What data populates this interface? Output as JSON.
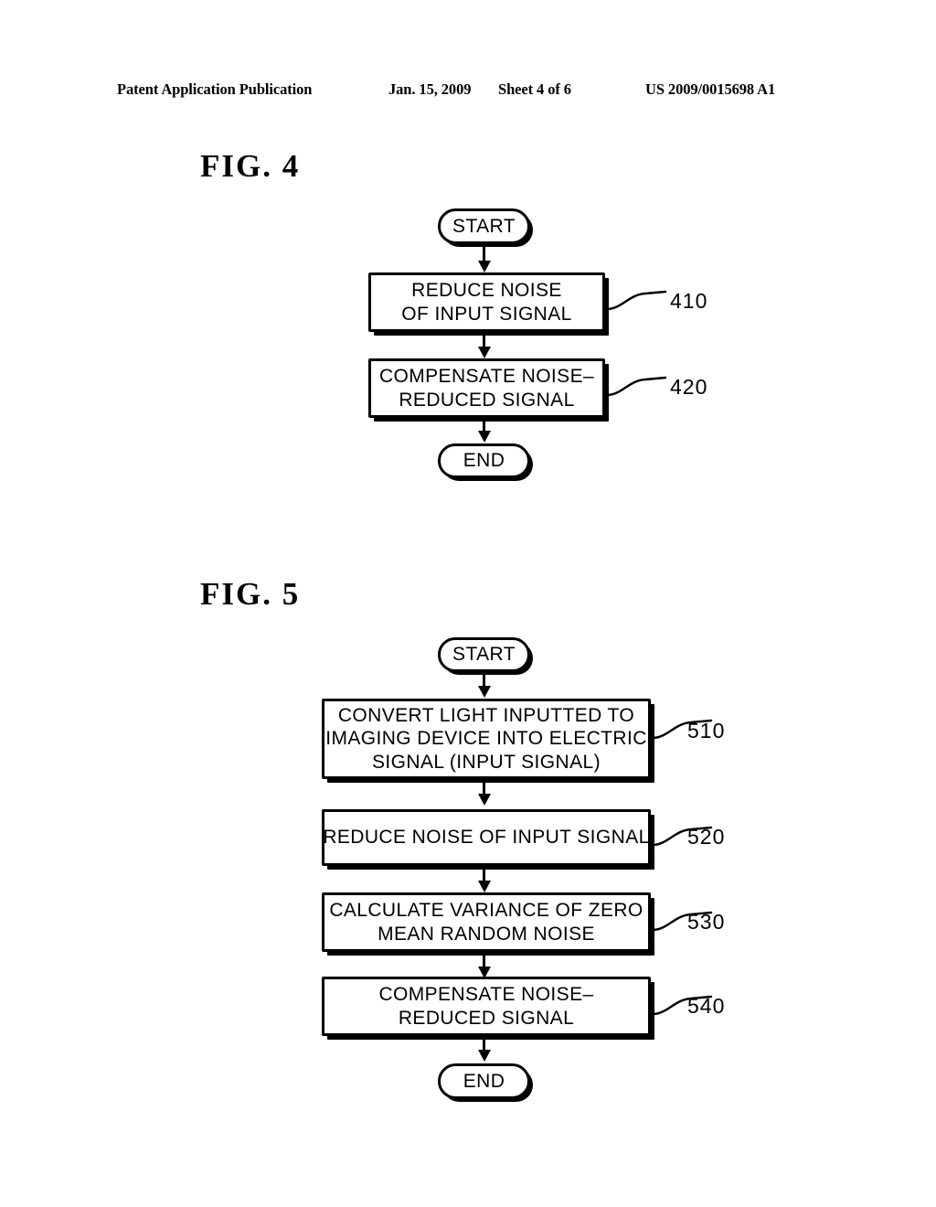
{
  "header": {
    "publication": "Patent Application Publication",
    "date": "Jan. 15, 2009",
    "sheet": "Sheet 4 of 6",
    "patent_number": "US 2009/0015698 A1"
  },
  "figures": [
    {
      "id": "fig4",
      "title": "FIG.  4",
      "nodes": [
        {
          "name": "start",
          "type": "terminal",
          "lines": [
            "START"
          ],
          "ref": null
        },
        {
          "name": "reduce-noise",
          "type": "process",
          "lines": [
            "REDUCE NOISE",
            "OF INPUT SIGNAL"
          ],
          "ref": "410"
        },
        {
          "name": "compensate",
          "type": "process",
          "lines": [
            "COMPENSATE NOISE–",
            "REDUCED SIGNAL"
          ],
          "ref": "420"
        },
        {
          "name": "end",
          "type": "terminal",
          "lines": [
            "END"
          ],
          "ref": null
        }
      ]
    },
    {
      "id": "fig5",
      "title": "FIG.  5",
      "nodes": [
        {
          "name": "start",
          "type": "terminal",
          "lines": [
            "START"
          ],
          "ref": null
        },
        {
          "name": "convert-light",
          "type": "process",
          "lines": [
            "CONVERT LIGHT INPUTTED TO",
            "IMAGING DEVICE INTO ELECTRIC",
            "SIGNAL (INPUT SIGNAL)"
          ],
          "ref": "510"
        },
        {
          "name": "reduce-noise",
          "type": "process",
          "lines": [
            "REDUCE NOISE OF INPUT SIGNAL"
          ],
          "ref": "520"
        },
        {
          "name": "calculate-variance",
          "type": "process",
          "lines": [
            "CALCULATE VARIANCE OF ZERO",
            "MEAN RANDOM NOISE"
          ],
          "ref": "530"
        },
        {
          "name": "compensate",
          "type": "process",
          "lines": [
            "COMPENSATE NOISE–",
            "REDUCED SIGNAL"
          ],
          "ref": "540"
        },
        {
          "name": "end",
          "type": "terminal",
          "lines": [
            "END"
          ],
          "ref": null
        }
      ]
    }
  ],
  "colors": {
    "ink": "#000000",
    "paper": "#ffffff"
  }
}
